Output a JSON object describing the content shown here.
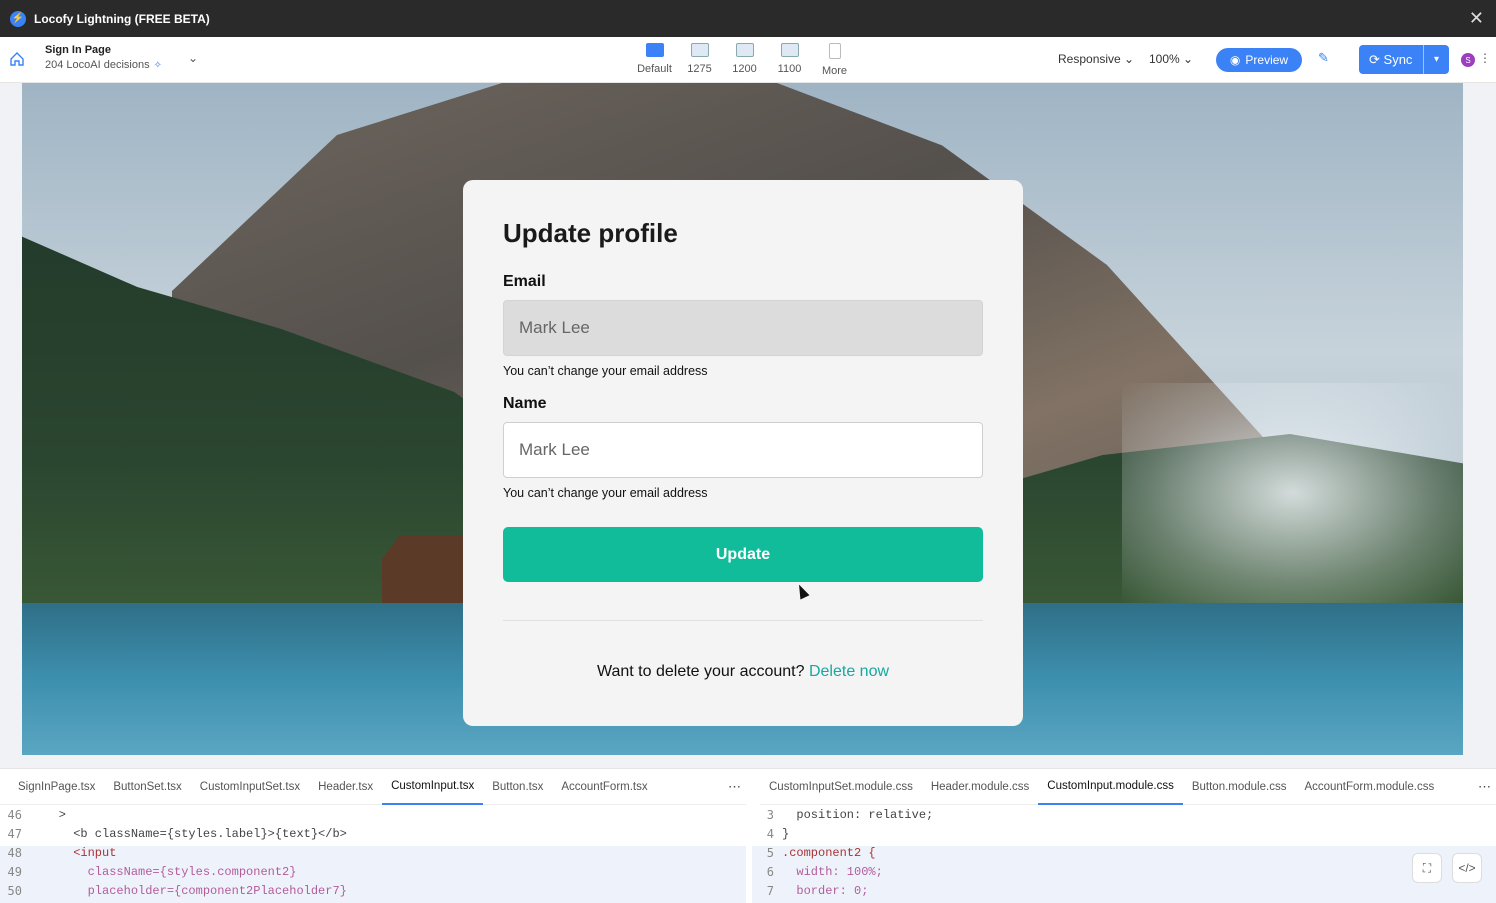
{
  "app": {
    "title": "Locofy Lightning (FREE BETA)"
  },
  "toolbar": {
    "page_name": "Sign In Page",
    "page_sub": "204 LocoAI decisions",
    "devices": [
      "Default",
      "1275",
      "1200",
      "1100",
      "More"
    ],
    "responsive_label": "Responsive",
    "zoom_label": "100%",
    "preview_label": "Preview",
    "sync_label": "Sync",
    "avatar_letter": "S"
  },
  "form": {
    "title": "Update profile",
    "email_label": "Email",
    "email_value": "Mark Lee",
    "email_hint": "You can’t change your email address",
    "name_label": "Name",
    "name_value": "Mark Lee",
    "name_hint": "You can’t change your email address",
    "button_label": "Update",
    "delete_prompt": "Want to delete your account?",
    "delete_link": "Delete now"
  },
  "code_panel": {
    "left_tabs": [
      "SignInPage.tsx",
      "ButtonSet.tsx",
      "CustomInputSet.tsx",
      "Header.tsx",
      "CustomInput.tsx",
      "Button.tsx",
      "AccountForm.tsx"
    ],
    "left_active": "CustomInput.tsx",
    "right_tabs": [
      "CustomInputSet.module.css",
      "Header.module.css",
      "CustomInput.module.css",
      "Button.module.css",
      "AccountForm.module.css"
    ],
    "right_active": "CustomInput.module.css",
    "left_lines": [
      {
        "n": "46",
        "text": "    >"
      },
      {
        "n": "47",
        "text": "      <b className={styles.label}>{text}</b>"
      },
      {
        "n": "48",
        "text": "      <input"
      },
      {
        "n": "49",
        "text": "        className={styles.component2}"
      },
      {
        "n": "50",
        "text": "        placeholder={component2Placeholder7}"
      }
    ],
    "right_lines": [
      {
        "n": "3",
        "text": "  position: relative;"
      },
      {
        "n": "4",
        "text": "}"
      },
      {
        "n": "5",
        "text": ".component2 {"
      },
      {
        "n": "6",
        "text": "  width: 100%;"
      },
      {
        "n": "7",
        "text": "  border: 0;"
      }
    ]
  },
  "colors": {
    "accent": "#3b82f6",
    "update_button": "#10bc9a",
    "delete_link": "#16a8a0"
  }
}
